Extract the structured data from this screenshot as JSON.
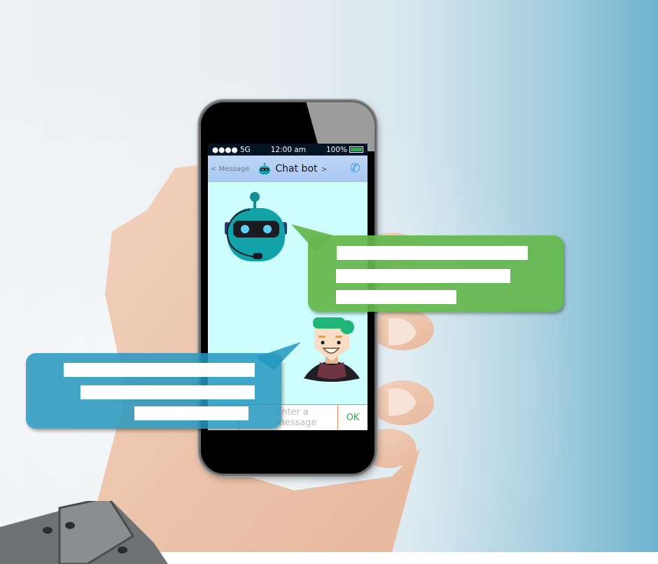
{
  "phone": {
    "statusbar": {
      "signal": "●●●● 5G",
      "time": "12:00 am",
      "battery": "100%"
    },
    "navbar": {
      "back_label": "< Message",
      "title": "Chat bot",
      "title_chevron": ">",
      "call_icon": "phone-icon"
    },
    "input": {
      "placeholder": "Enter a message",
      "ok_label": "OK"
    }
  },
  "bubbles": [
    {
      "from": "bot",
      "color": "#64b74e",
      "line_count": 3
    },
    {
      "from": "user",
      "color": "#2496be",
      "line_count": 3
    }
  ],
  "colors": {
    "statusbar": "#031524",
    "navbar": "#b4cff5",
    "chat_bg": "#cdfdfd",
    "input_border": "#f08a5d",
    "ok_text": "#34a853",
    "call_icon": "#1ca4e4",
    "bot_body": "#12a0a8"
  }
}
